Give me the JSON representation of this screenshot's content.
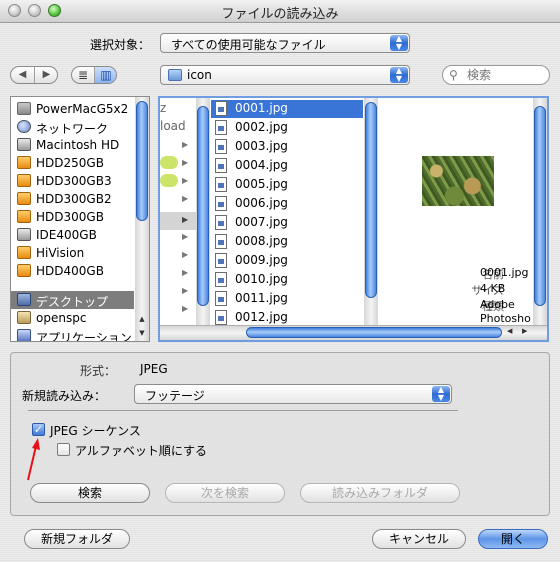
{
  "window": {
    "title": "ファイルの読み込み"
  },
  "toolbar": {
    "enable_label": "選択対象：",
    "enable_value": "すべての使用可能なファイル",
    "back_icon": "◀",
    "forward_icon": "▶",
    "list_view_icon": "≣",
    "column_view_icon": "▥",
    "location": "icon",
    "search_placeholder": "検索"
  },
  "sidebar": {
    "items": [
      {
        "label": "PowerMacG5x2",
        "icon": "computer-icon"
      },
      {
        "label": "ネットワーク",
        "icon": "network-icon"
      },
      {
        "label": "Macintosh HD",
        "icon": "hard-drive-icon"
      },
      {
        "label": "HDD250GB",
        "icon": "hard-drive-icon"
      },
      {
        "label": "HDD300GB3",
        "icon": "hard-drive-icon"
      },
      {
        "label": "HDD300GB2",
        "icon": "hard-drive-icon"
      },
      {
        "label": "HDD300GB",
        "icon": "hard-drive-icon"
      },
      {
        "label": "IDE400GB",
        "icon": "hard-drive-icon"
      },
      {
        "label": "HiVision",
        "icon": "hard-drive-icon"
      },
      {
        "label": "HDD400GB",
        "icon": "hard-drive-icon"
      },
      {
        "label": "デスクトップ",
        "icon": "desktop-icon",
        "selected": true
      },
      {
        "label": "openspc",
        "icon": "home-icon"
      },
      {
        "label": "アプリケーション",
        "icon": "applications-icon"
      }
    ]
  },
  "browser": {
    "prev_column_fragments": [
      "z",
      "load"
    ],
    "files": [
      "0001.jpg",
      "0002.jpg",
      "0003.jpg",
      "0004.jpg",
      "0005.jpg",
      "0006.jpg",
      "0007.jpg",
      "0008.jpg",
      "0009.jpg",
      "0010.jpg",
      "0011.jpg",
      "0012.jpg"
    ],
    "selected_file": "0001.jpg",
    "preview": {
      "name_label": "名前",
      "name_value": "0001.jpg",
      "size_label": "サイズ",
      "size_value": "4 KB",
      "kind_label": "種類",
      "kind_value_1": "Adobe",
      "kind_value_2": "Photosho"
    }
  },
  "options": {
    "format_label": "形式：",
    "format_value": "JPEG",
    "import_as_label": "新規読み込み：",
    "import_as_value": "フッテージ",
    "jpeg_sequence_label": "JPEG シーケンス",
    "jpeg_sequence_checked": true,
    "alphabetical_label": "アルファベット順にする",
    "alphabetical_checked": false,
    "find_button": "検索",
    "find_again_button": "次を検索",
    "import_folder_button": "読み込みフォルダ"
  },
  "footer": {
    "new_folder_button": "新規フォルダ",
    "cancel_button": "キャンセル",
    "open_button": "開く"
  },
  "colors": {
    "accent": "#3875d7",
    "annotation_arrow": "#e8101a"
  }
}
